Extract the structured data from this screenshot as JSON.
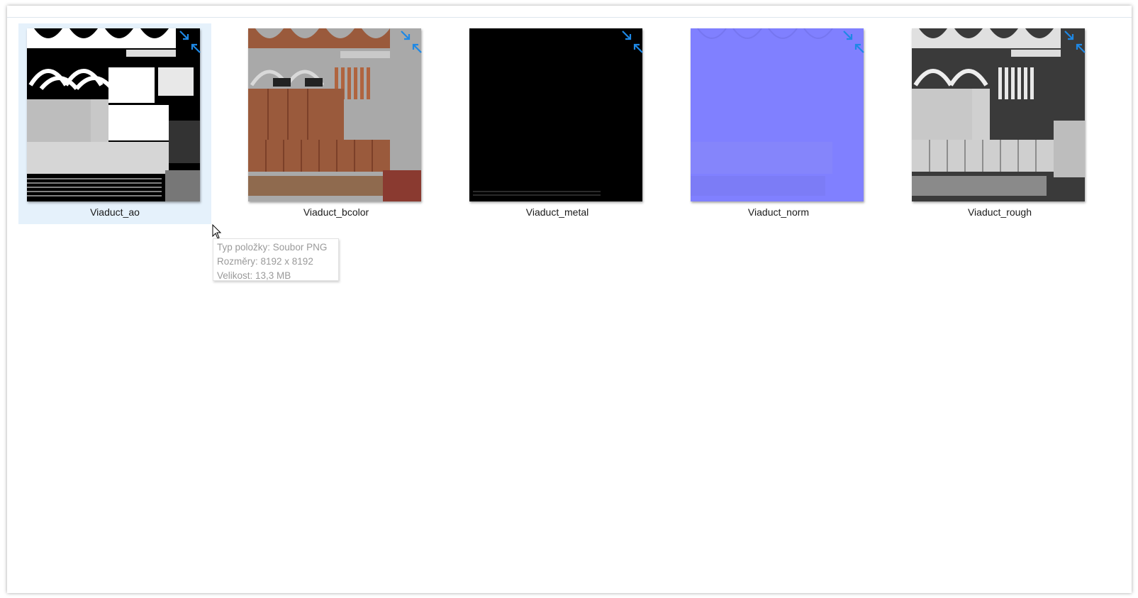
{
  "files": [
    {
      "name": "Viaduct_ao",
      "selected": true,
      "map": "ao"
    },
    {
      "name": "Viaduct_bcolor",
      "selected": false,
      "map": "bcolor"
    },
    {
      "name": "Viaduct_metal",
      "selected": false,
      "map": "metal"
    },
    {
      "name": "Viaduct_norm",
      "selected": false,
      "map": "norm"
    },
    {
      "name": "Viaduct_rough",
      "selected": false,
      "map": "rough"
    }
  ],
  "overlay_icon": "compressed-arrows-icon",
  "tooltip": {
    "type": "Typ položky: Soubor PNG",
    "dimensions": "Rozměry: 8192 x 8192",
    "size": "Velikost: 13,3 MB"
  },
  "colors": {
    "selection": "#e5f1fb",
    "compress_arrows": "#1e88e5",
    "norm_base": "#8080ff",
    "bcolor_brick": "#9a5a3c"
  }
}
